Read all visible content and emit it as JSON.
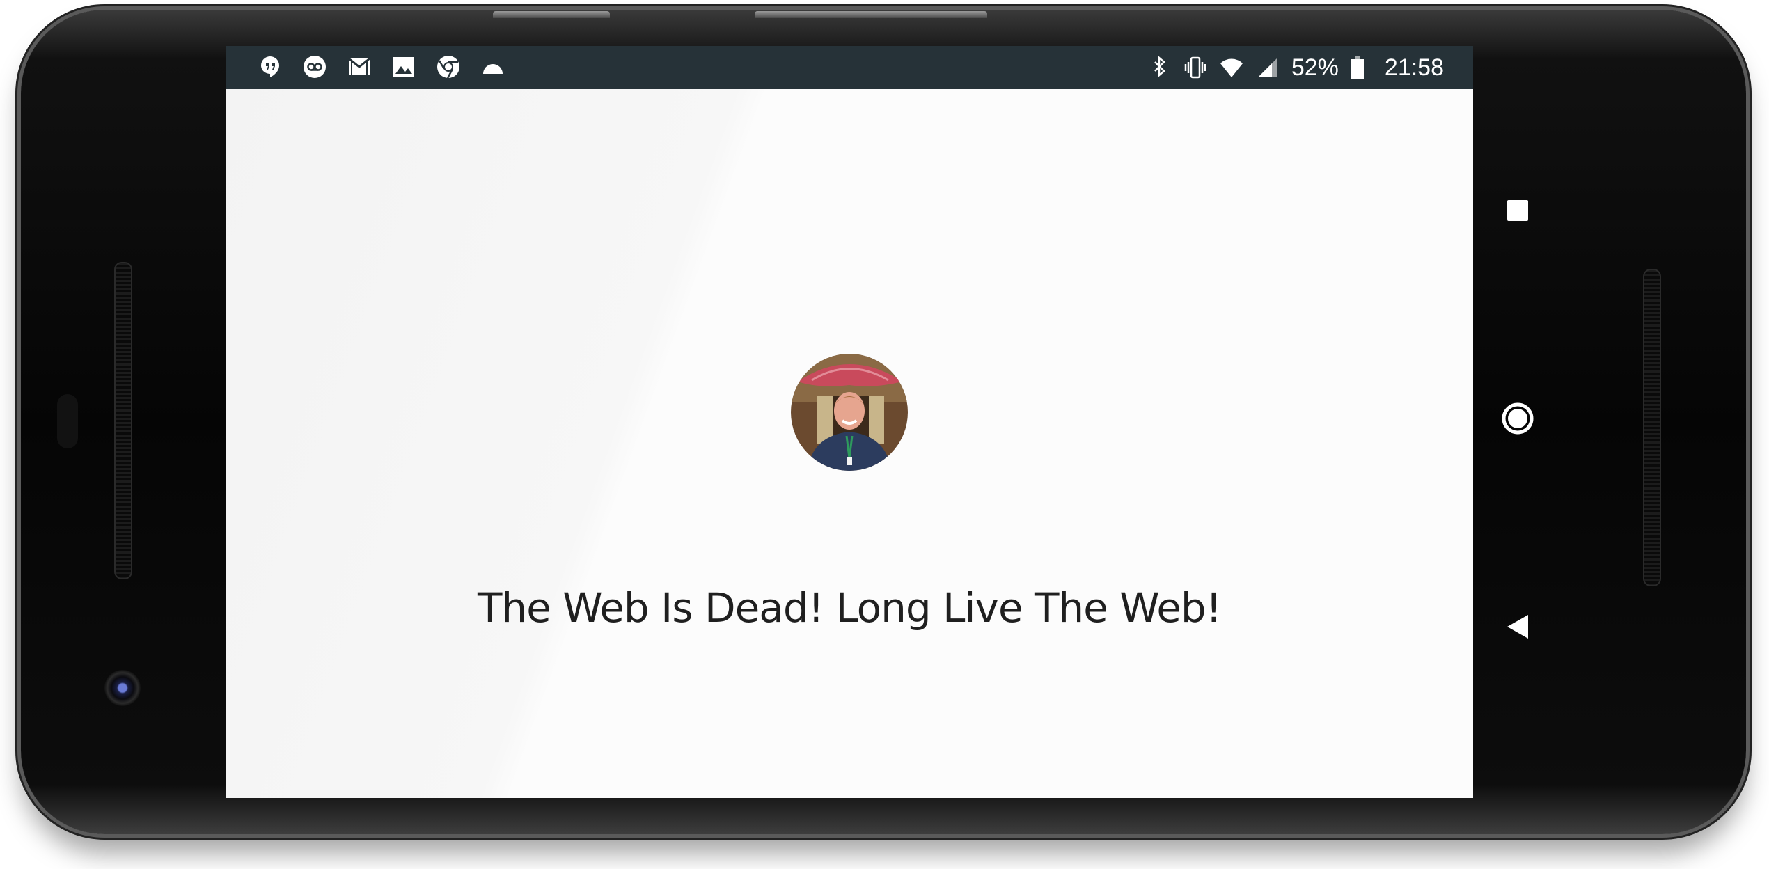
{
  "status_bar": {
    "notification_icons": [
      "hangouts-icon",
      "voicemail-icon",
      "gmail-icon",
      "photos-icon",
      "chrome-icon",
      "android-icon"
    ],
    "system_icons": [
      "bluetooth-icon",
      "vibrate-icon",
      "wifi-icon",
      "cell-signal-icon",
      "battery-icon"
    ],
    "battery_percent": "52%",
    "time": "21:58",
    "background_color": "#263238"
  },
  "main": {
    "avatar": "profile-photo",
    "headline": "The Web Is Dead! Long Live The Web!"
  },
  "nav_bar": {
    "buttons": [
      "recent-apps-icon",
      "home-icon",
      "back-icon"
    ]
  }
}
